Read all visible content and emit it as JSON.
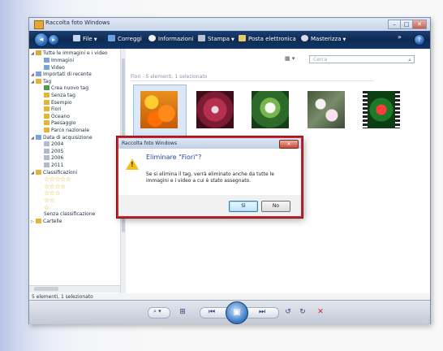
{
  "window": {
    "title": "Raccolta foto Windows"
  },
  "toolbar": {
    "file": "File",
    "correggi": "Correggi",
    "informazioni": "Informazioni",
    "stampa": "Stampa",
    "posta": "Posta elettronica",
    "masterizza": "Masterizza",
    "more": "»"
  },
  "sidebar": {
    "items": [
      {
        "label": "Tutte le immagini e i video",
        "indent": 0
      },
      {
        "label": "Immagini",
        "indent": 1
      },
      {
        "label": "Video",
        "indent": 1
      },
      {
        "label": "Importati di recente",
        "indent": 0
      },
      {
        "label": "Tag",
        "indent": 0
      },
      {
        "label": "Crea nuovo tag",
        "indent": 1
      },
      {
        "label": "Senza tag",
        "indent": 1
      },
      {
        "label": "Esempio",
        "indent": 1
      },
      {
        "label": "Fiori",
        "indent": 1
      },
      {
        "label": "Oceano",
        "indent": 1
      },
      {
        "label": "Paesaggio",
        "indent": 1
      },
      {
        "label": "Parco nazionale",
        "indent": 1
      },
      {
        "label": "Data di acquisizione",
        "indent": 0
      },
      {
        "label": "2004",
        "indent": 1
      },
      {
        "label": "2005",
        "indent": 1
      },
      {
        "label": "2006",
        "indent": 1
      },
      {
        "label": "2011",
        "indent": 1
      },
      {
        "label": "Classificazioni",
        "indent": 0
      }
    ],
    "ratings": [
      "☆☆☆☆☆",
      "☆☆☆☆",
      "☆☆☆",
      "☆☆",
      "☆"
    ],
    "no_rating": "Senza classificazione",
    "folders": "Cartelle"
  },
  "main": {
    "search_placeholder": "Cerca",
    "group_header": "Fiori - 5 elementi, 1 selezionato"
  },
  "status": {
    "text": "5 elementi, 1 selezionato"
  },
  "dialog": {
    "title": "Raccolta foto Windows",
    "heading": "Eliminare \"Fiori\"?",
    "message": "Se si elimina il tag, verrà eliminato anche da tutte le immagini e i video a cui è stato assegnato.",
    "yes": "Sì",
    "no": "No"
  }
}
